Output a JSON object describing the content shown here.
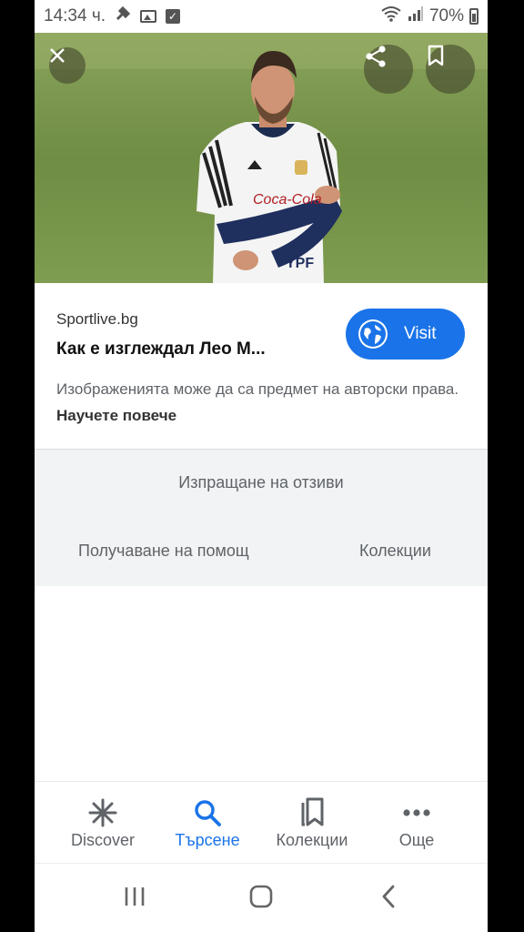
{
  "status_bar": {
    "time": "14:34 ч.",
    "battery": "70%",
    "icons": [
      "tool-icon",
      "image-icon",
      "checkbox-icon",
      "wifi-icon",
      "signal-icon",
      "battery-icon"
    ]
  },
  "hero": {
    "jersey_text": "Coca-Cola",
    "jersey_text_2": "YPF",
    "actions": [
      "close-icon",
      "share-icon",
      "bookmark-icon"
    ]
  },
  "result": {
    "source": "Sportlive.bg",
    "title": "Как е изглеждал Лео М...",
    "visit_label": "Visit",
    "copyright_text": "Изображенията може да са предмет на авторски права.",
    "learn_more": "Научете повече"
  },
  "feedback": {
    "send_feedback": "Изпращане на отзиви",
    "get_help": "Получаване на помощ",
    "collections": "Колекции"
  },
  "bottom_nav": {
    "items": [
      {
        "label": "Discover",
        "icon": "asterisk-icon"
      },
      {
        "label": "Търсене",
        "icon": "search-icon"
      },
      {
        "label": "Колекции",
        "icon": "collections-icon"
      },
      {
        "label": "Още",
        "icon": "more-icon"
      }
    ],
    "active_index": 1
  },
  "system_nav": [
    "recents-icon",
    "home-icon",
    "back-icon"
  ],
  "colors": {
    "accent": "#1a73e8",
    "panel": "#f1f3f4",
    "text_secondary": "#5f6368"
  }
}
